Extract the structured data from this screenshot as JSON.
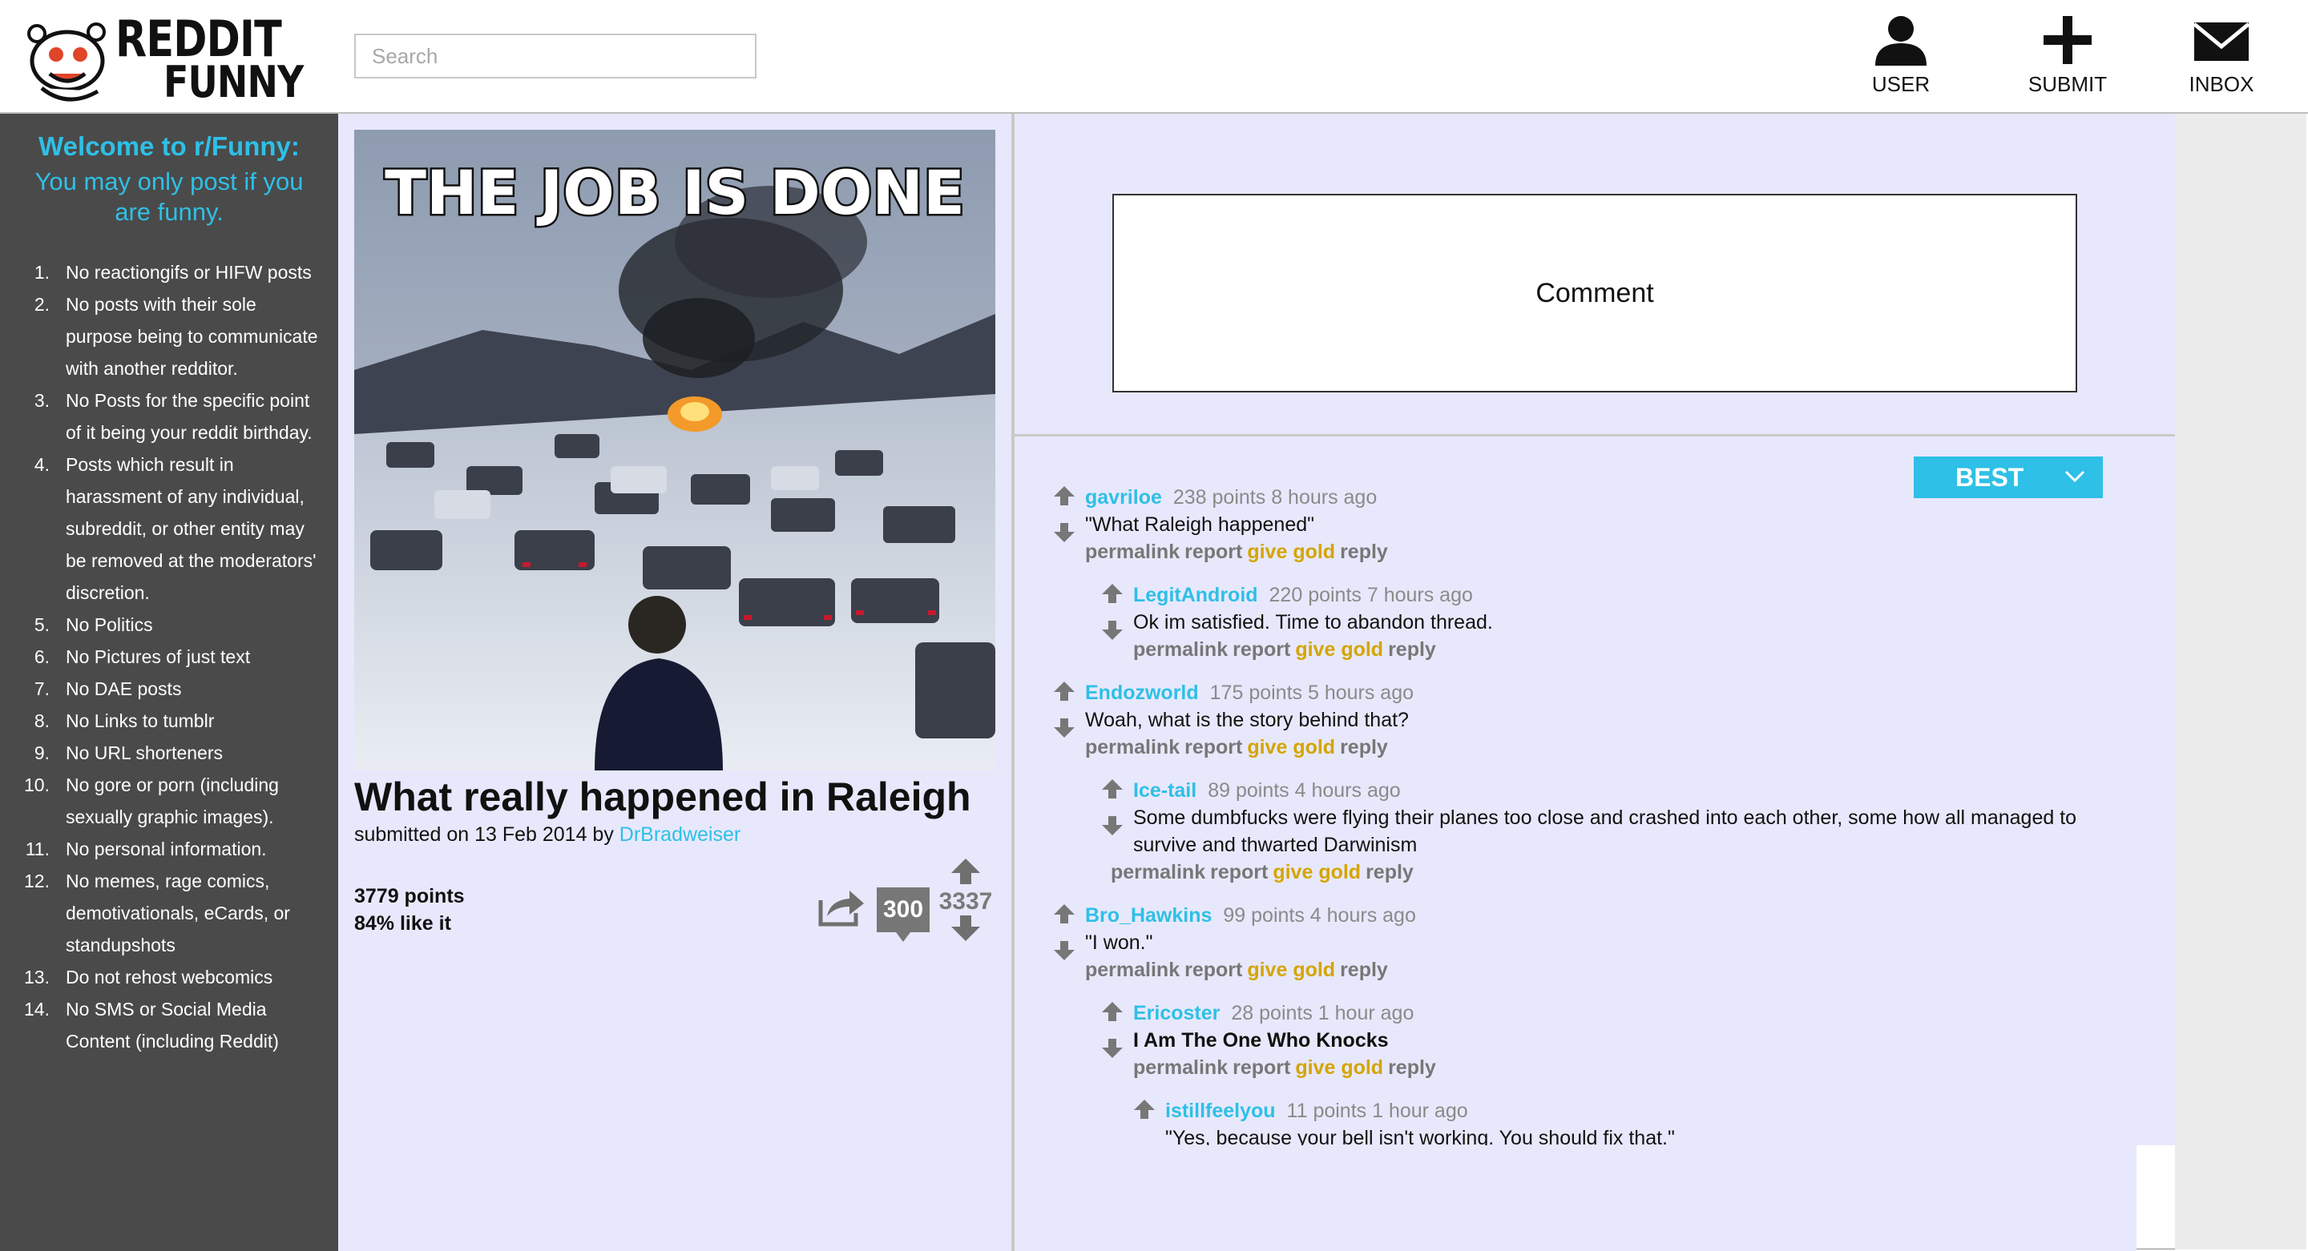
{
  "header": {
    "logo_line1": "REDDIT",
    "logo_line2": "FUNNY",
    "search_placeholder": "Search",
    "buttons": [
      {
        "label": "USER",
        "icon": "user-icon"
      },
      {
        "label": "SUBMIT",
        "icon": "plus-icon"
      },
      {
        "label": "INBOX",
        "icon": "envelope-icon"
      }
    ]
  },
  "sidebar": {
    "title": "Welcome to r/Funny:",
    "subtitle": "You may only post if you are funny.",
    "rules": [
      {
        "num": "1.",
        "text": "No reactiongifs or HIFW posts"
      },
      {
        "num": "2.",
        "text": "No posts with their sole purpose being to communicate with another redditor."
      },
      {
        "num": "3.",
        "text": "No Posts for the specific point of it being your reddit birthday."
      },
      {
        "num": "4.",
        "text": "Posts which result in harassment of any individual, subreddit, or other entity may be removed at the moderators' discretion."
      },
      {
        "num": "5.",
        "text": "No Politics"
      },
      {
        "num": "6.",
        "text": "No Pictures of just text"
      },
      {
        "num": "7.",
        "text": "No DAE posts"
      },
      {
        "num": "8.",
        "text": "No Links to tumblr"
      },
      {
        "num": "9.",
        "text": "No URL shorteners"
      },
      {
        "num": "10.",
        "text": "No gore or porn (including sexually graphic images)."
      },
      {
        "num": "11.",
        "text": "No personal information."
      },
      {
        "num": "12.",
        "text": "No memes, rage comics, demotivationals, eCards, or standupshots"
      },
      {
        "num": "13.",
        "text": "Do not rehost webcomics"
      },
      {
        "num": "14.",
        "text": "No SMS or Social Media Content (including Reddit)"
      }
    ]
  },
  "post": {
    "image_caption": "THE JOB IS DONE",
    "title": "What really happened in Raleigh",
    "submitted_prefix": "submitted on 13 Feb 2014 by",
    "author": "DrBradweiser",
    "points": "3779 points",
    "like_pct": "84% like it",
    "comment_count": "300",
    "score": "3337"
  },
  "comment_box": {
    "placeholder": "Comment"
  },
  "sort": {
    "label": "BEST"
  },
  "comment_links": {
    "permalink": "permalink",
    "report": "report",
    "give_gold": "give gold",
    "reply": "reply"
  },
  "comments": [
    {
      "user": "gavriloe",
      "meta": "238 points 8 hours ago",
      "body": "\"What Raleigh happened\""
    },
    {
      "user": "LegitAndroid",
      "meta": "220 points 7 hours ago",
      "body": "Ok im satisfied. Time to abandon thread."
    },
    {
      "user": "Endozworld",
      "meta": "175 points 5 hours ago",
      "body": "Woah, what is the story behind that?"
    },
    {
      "user": "Ice-tail",
      "meta": "89 points 4 hours ago",
      "body": "Some dumbfucks were flying their planes too close and crashed into each other, some how all managed to survive and thwarted Darwinism"
    },
    {
      "user": "Bro_Hawkins",
      "meta": "99 points 4 hours ago",
      "body": "\"I won.\""
    },
    {
      "user": "Ericoster",
      "meta": "28 points 1 hour ago",
      "body": "I Am The One Who Knocks"
    },
    {
      "user": "istillfeelyou",
      "meta": "11 points 1 hour ago",
      "body": "\"Yes, because your bell isn't working. You should fix that.\""
    }
  ],
  "colors": {
    "accent": "#2ec0e6",
    "gold": "#d4a500",
    "sidebar_bg": "#4a4a4a",
    "content_bg": "#e8e8fc"
  }
}
